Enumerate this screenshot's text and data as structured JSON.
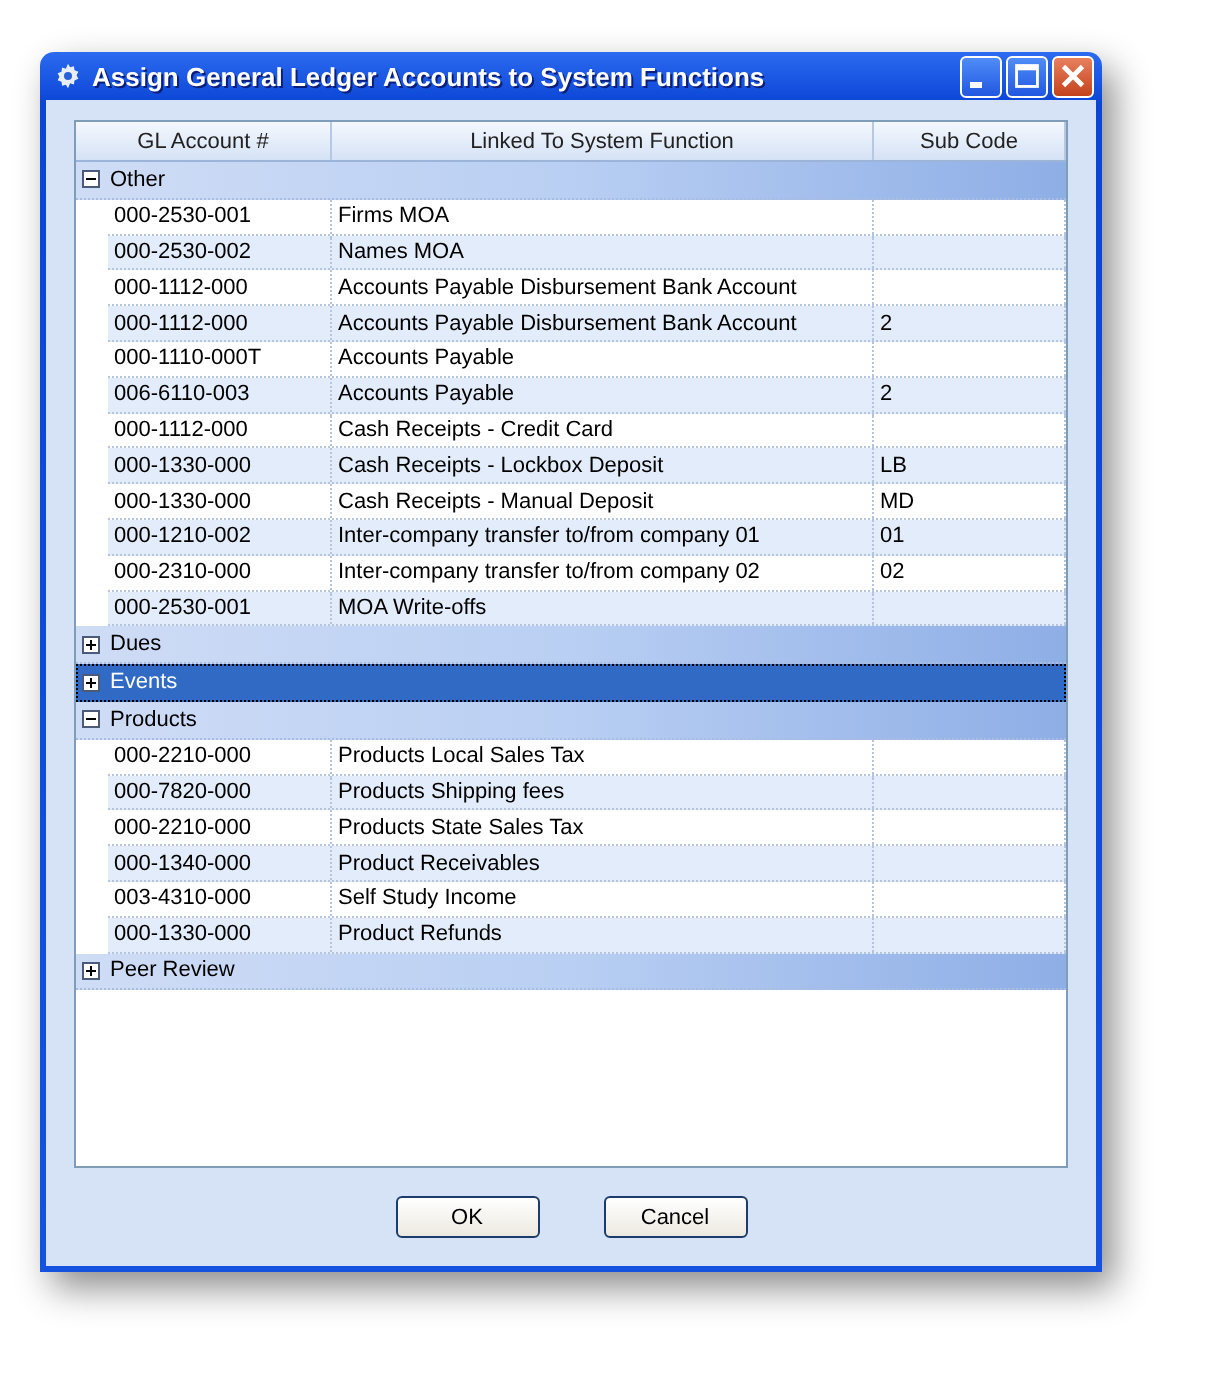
{
  "window": {
    "title": "Assign General Ledger Accounts to System Functions"
  },
  "table": {
    "columns": [
      "GL Account #",
      "Linked To System Function",
      "Sub Code"
    ],
    "groups": [
      {
        "name": "Other",
        "expanded": true,
        "selected": false,
        "rows": [
          {
            "account": "000-2530-001",
            "function": "Firms MOA",
            "sub_code": ""
          },
          {
            "account": "000-2530-002",
            "function": "Names MOA",
            "sub_code": ""
          },
          {
            "account": "000-1112-000",
            "function": "Accounts Payable Disbursement Bank Account",
            "sub_code": ""
          },
          {
            "account": "000-1112-000",
            "function": "Accounts Payable Disbursement Bank Account",
            "sub_code": "2"
          },
          {
            "account": "000-1110-000T",
            "function": "Accounts Payable",
            "sub_code": ""
          },
          {
            "account": "006-6110-003",
            "function": "Accounts Payable",
            "sub_code": "2"
          },
          {
            "account": "000-1112-000",
            "function": "Cash Receipts - Credit Card",
            "sub_code": ""
          },
          {
            "account": "000-1330-000",
            "function": "Cash Receipts - Lockbox Deposit",
            "sub_code": "LB"
          },
          {
            "account": "000-1330-000",
            "function": "Cash Receipts - Manual Deposit",
            "sub_code": "MD"
          },
          {
            "account": "000-1210-002",
            "function": "Inter-company transfer to/from company 01",
            "sub_code": "01"
          },
          {
            "account": "000-2310-000",
            "function": "Inter-company transfer to/from company 02",
            "sub_code": "02"
          },
          {
            "account": "000-2530-001",
            "function": "MOA Write-offs",
            "sub_code": ""
          }
        ]
      },
      {
        "name": "Dues",
        "expanded": false,
        "selected": false
      },
      {
        "name": "Events",
        "expanded": false,
        "selected": true
      },
      {
        "name": "Products",
        "expanded": true,
        "selected": false,
        "rows": [
          {
            "account": "000-2210-000",
            "function": "Products Local Sales Tax",
            "sub_code": ""
          },
          {
            "account": "000-7820-000",
            "function": "Products Shipping fees",
            "sub_code": ""
          },
          {
            "account": "000-2210-000",
            "function": "Products State Sales Tax",
            "sub_code": ""
          },
          {
            "account": "000-1340-000",
            "function": "Product Receivables",
            "sub_code": ""
          },
          {
            "account": "003-4310-000",
            "function": "Self Study Income",
            "sub_code": ""
          },
          {
            "account": "000-1330-000",
            "function": "Product Refunds",
            "sub_code": ""
          }
        ]
      },
      {
        "name": "Peer Review",
        "expanded": false,
        "selected": false
      }
    ]
  },
  "buttons": [
    "OK",
    "Cancel"
  ]
}
